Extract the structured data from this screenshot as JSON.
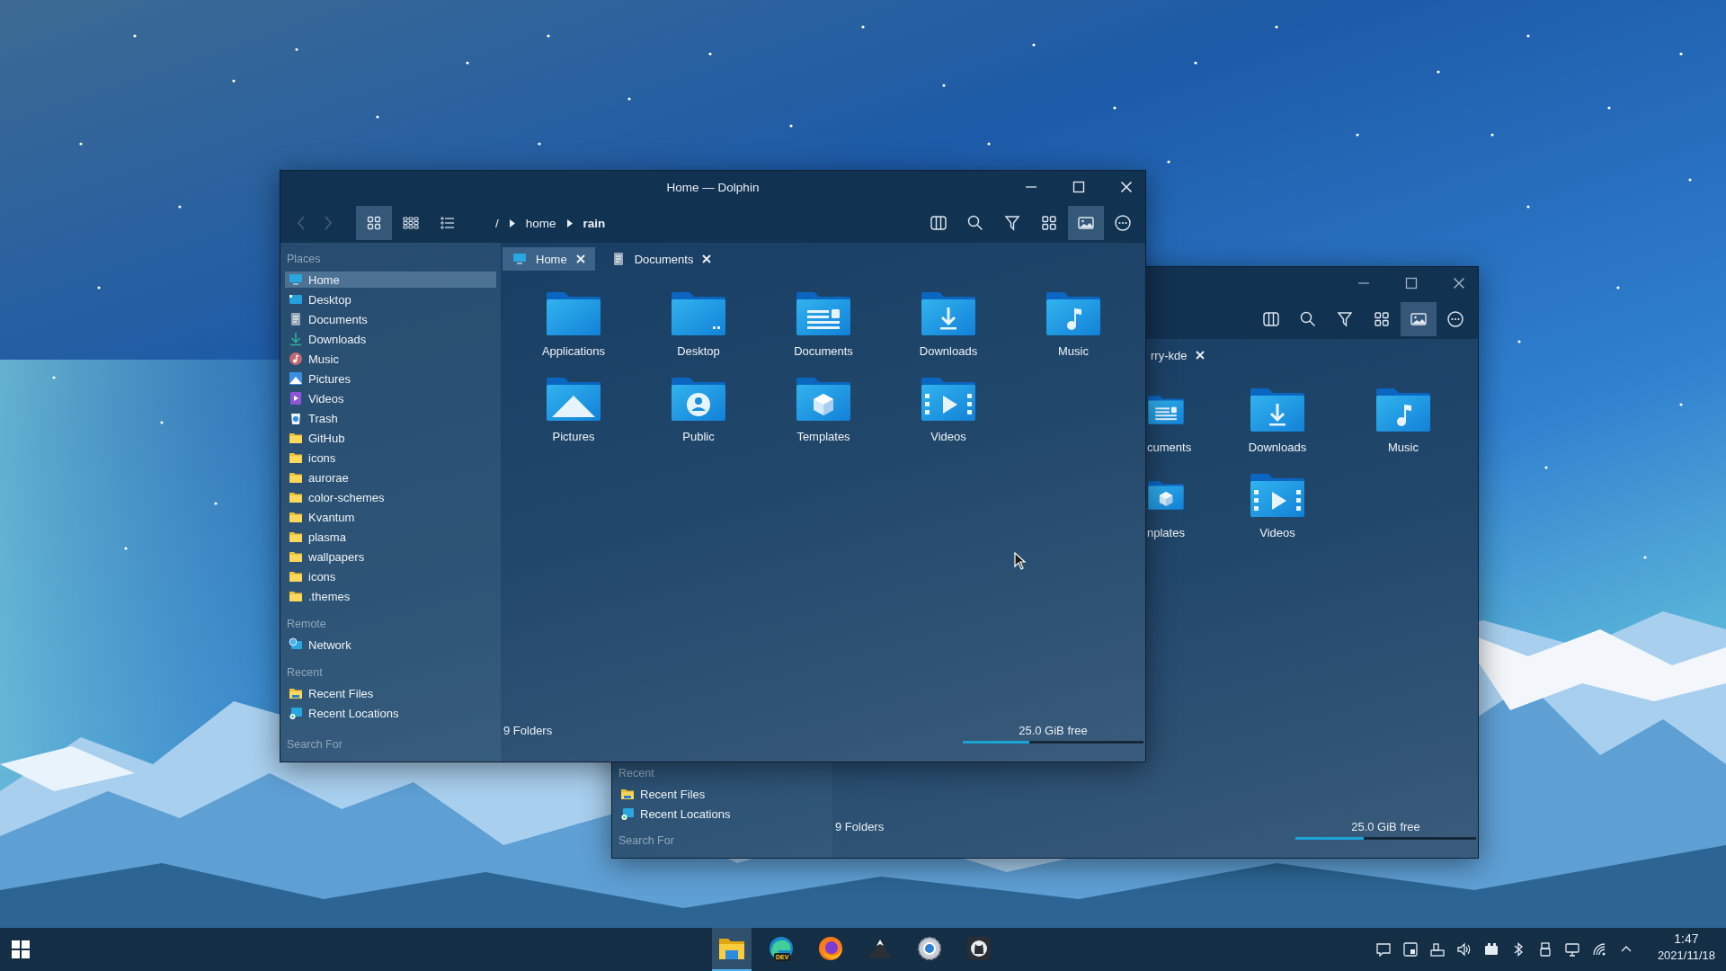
{
  "front_window": {
    "title": "Home — Dolphin",
    "view_modes": [
      {
        "kind": "icons",
        "selected": true
      },
      {
        "kind": "compact",
        "selected": false
      },
      {
        "kind": "details",
        "selected": false
      }
    ],
    "breadcrumb": [
      {
        "label": "/",
        "current": false
      },
      {
        "label": "home",
        "current": false
      },
      {
        "label": "rain",
        "current": true
      }
    ],
    "tools": [
      {
        "kind": "split",
        "selected": false
      },
      {
        "kind": "search",
        "selected": false
      },
      {
        "kind": "filter",
        "selected": false
      },
      {
        "kind": "grid",
        "selected": false
      },
      {
        "kind": "preview",
        "selected": true
      },
      {
        "kind": "more",
        "selected": false
      }
    ],
    "tabs": [
      {
        "label": "Home",
        "kind": "computer",
        "selected": true
      },
      {
        "label": "Documents",
        "kind": "document",
        "selected": false
      }
    ],
    "sidebar": [
      {
        "heading": "Places",
        "items": [
          {
            "label": "Home",
            "kind": "computer",
            "selected": true
          },
          {
            "label": "Desktop",
            "kind": "desktop",
            "selected": false
          },
          {
            "label": "Documents",
            "kind": "document",
            "selected": false
          },
          {
            "label": "Downloads",
            "kind": "download",
            "selected": false
          },
          {
            "label": "Music",
            "kind": "music",
            "selected": false
          },
          {
            "label": "Pictures",
            "kind": "picture",
            "selected": false
          },
          {
            "label": "Videos",
            "kind": "video",
            "selected": false
          },
          {
            "label": "Trash",
            "kind": "trash",
            "selected": false
          },
          {
            "label": "GitHub",
            "kind": "folder",
            "selected": false
          },
          {
            "label": "icons",
            "kind": "folder",
            "selected": false
          },
          {
            "label": "aurorae",
            "kind": "folder",
            "selected": false
          },
          {
            "label": "color-schemes",
            "kind": "folder",
            "selected": false
          },
          {
            "label": "Kvantum",
            "kind": "folder",
            "selected": false
          },
          {
            "label": "plasma",
            "kind": "folder",
            "selected": false
          },
          {
            "label": "wallpapers",
            "kind": "folder",
            "selected": false
          },
          {
            "label": "icons",
            "kind": "folder",
            "selected": false
          },
          {
            "label": ".themes",
            "kind": "folder",
            "selected": false
          }
        ]
      },
      {
        "heading": "Remote",
        "items": [
          {
            "label": "Network",
            "kind": "network",
            "selected": false
          }
        ]
      },
      {
        "heading": "Recent",
        "items": [
          {
            "label": "Recent Files",
            "kind": "recent-files",
            "selected": false
          },
          {
            "label": "Recent Locations",
            "kind": "recent-locations",
            "selected": false
          }
        ]
      }
    ],
    "sidebar_footer": "Search For",
    "folders": [
      {
        "label": "Applications",
        "kind": "plain"
      },
      {
        "label": "Desktop",
        "kind": "desktop"
      },
      {
        "label": "Documents",
        "kind": "documents"
      },
      {
        "label": "Downloads",
        "kind": "downloads"
      },
      {
        "label": "Music",
        "kind": "music"
      },
      {
        "label": "Pictures",
        "kind": "pictures"
      },
      {
        "label": "Public",
        "kind": "public"
      },
      {
        "label": "Templates",
        "kind": "templates"
      },
      {
        "label": "Videos",
        "kind": "videos"
      }
    ],
    "status": {
      "count": "9 Folders",
      "free": "25.0 GiB free",
      "level": 0.37
    }
  },
  "back_window": {
    "tools": [
      {
        "kind": "split",
        "selected": false
      },
      {
        "kind": "search",
        "selected": false
      },
      {
        "kind": "filter",
        "selected": false
      },
      {
        "kind": "grid",
        "selected": false
      },
      {
        "kind": "preview",
        "selected": true
      },
      {
        "kind": "more",
        "selected": false
      }
    ],
    "tab_label": "rry-kde",
    "folders": [
      {
        "label": "cuments",
        "kind": "documents"
      },
      {
        "label": "Downloads",
        "kind": "downloads"
      },
      {
        "label": "Music",
        "kind": "music"
      },
      {
        "label": "nplates",
        "kind": "templates"
      },
      {
        "label": "Videos",
        "kind": "videos"
      }
    ],
    "sidebar": {
      "heading": "Recent",
      "items": [
        {
          "label": "Recent Files",
          "kind": "recent-files",
          "selected": false
        },
        {
          "label": "Recent Locations",
          "kind": "recent-locations",
          "selected": false
        }
      ]
    },
    "sidebar_footer": "Search For",
    "status": {
      "count": "9 Folders",
      "free": "25.0 GiB free",
      "level": 0.38
    }
  },
  "taskbar": {
    "apps": [
      {
        "kind": "files",
        "selected": true
      },
      {
        "kind": "browser-dev",
        "selected": false,
        "badge": "DEV"
      },
      {
        "kind": "browser",
        "selected": false
      },
      {
        "kind": "mountain",
        "selected": false
      },
      {
        "kind": "settings",
        "selected": false
      },
      {
        "kind": "cat",
        "selected": false
      }
    ],
    "tray": [
      {
        "kind": "messages"
      },
      {
        "kind": "window"
      },
      {
        "kind": "dock"
      },
      {
        "kind": "volume"
      },
      {
        "kind": "battery"
      },
      {
        "kind": "bluetooth"
      },
      {
        "kind": "usb"
      },
      {
        "kind": "display"
      },
      {
        "kind": "wifi"
      },
      {
        "kind": "expand"
      }
    ],
    "time": "1:47",
    "date": "2021/11/18"
  }
}
